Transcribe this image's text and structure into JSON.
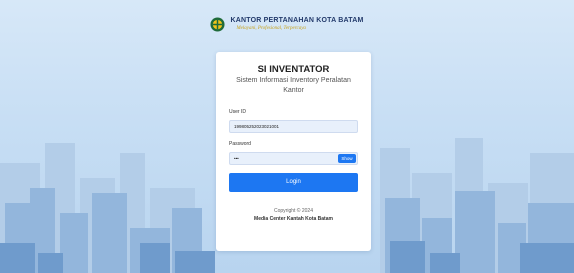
{
  "header": {
    "org_name": "KANTOR PERTANAHAN KOTA BATAM",
    "tagline": "Melayani, Profesional, Terpercaya"
  },
  "app": {
    "title": "SI INVENTATOR",
    "subtitle": "Sistem Informasi Inventory Peralatan Kantor"
  },
  "form": {
    "user_id_label": "User ID",
    "user_id_value": "199805252023021001",
    "password_label": "Password",
    "password_value": "•••",
    "show_label": "Show",
    "login_label": "Login"
  },
  "footer": {
    "copyright": "Copyright © 2024",
    "company": "Media Center Kantah Kota Batam"
  },
  "colors": {
    "primary": "#1d77f2",
    "input_bg": "#e8f0fb",
    "header_text": "#233a6b",
    "tagline_text": "#c9a21b"
  }
}
